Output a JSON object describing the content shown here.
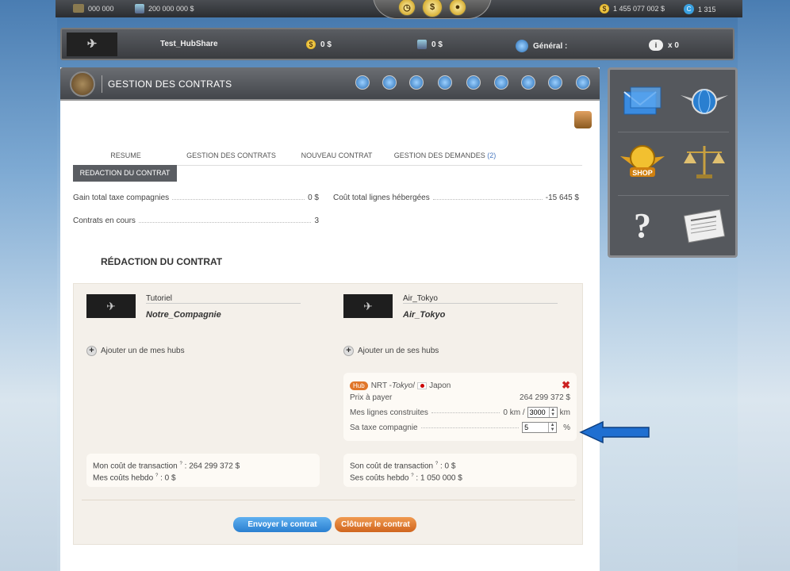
{
  "topbar": {
    "left_value": "000 000",
    "cash": "200 000 000 $",
    "right_cash": "1 455 077 002 $",
    "credits": "1 315"
  },
  "airline": {
    "name": "Test_HubShare",
    "money1": "0 $",
    "money2": "0 $",
    "general_label": "Général :",
    "messages": "x 0"
  },
  "header": {
    "title": "GESTION DES CONTRATS"
  },
  "tabs": [
    {
      "label": "RESUME"
    },
    {
      "label": "GESTION DES CONTRATS"
    },
    {
      "label": "NOUVEAU CONTRAT"
    },
    {
      "label": "GESTION DES DEMANDES",
      "count": "(2)"
    }
  ],
  "subtab": "REDACTION DU CONTRAT",
  "stats": {
    "gain_label": "Gain total taxe compagnies",
    "gain_value": "0 $",
    "cost_label": "Coût total lignes hébergées",
    "cost_value": "-15 645 $",
    "contracts_label": "Contrats en cours",
    "contracts_value": "3"
  },
  "section_title": "RÉDACTION DU CONTRAT",
  "left_party": {
    "name": "Tutoriel",
    "company": "Notre_Compagnie",
    "add_hub": "Ajouter un de mes hubs"
  },
  "right_party": {
    "name": "Air_Tokyo",
    "company": "Air_Tokyo",
    "add_hub": "Ajouter un de ses hubs"
  },
  "hub": {
    "badge": "Hub",
    "code": "NRT - ",
    "city": "Tokyo",
    "sep": " / ",
    "country": "Japon",
    "price_label": "Prix à payer",
    "price_value": "264 299 372 $",
    "lines_label": "Mes lignes construites",
    "lines_prefix": "0 km /",
    "lines_value": "3000",
    "lines_unit": "km",
    "tax_label": "Sa taxe compagnie",
    "tax_value": "5",
    "tax_unit": "%"
  },
  "left_costs": {
    "line1_label": "Mon coût de transaction",
    "line1_value": ": 264 299 372 $",
    "line2_label": "Mes coûts hebdo",
    "line2_value": ": 0 $"
  },
  "right_costs": {
    "line1_label": "Son coût de transaction",
    "line1_value": ": 0 $",
    "line2_label": "Ses coûts hebdo",
    "line2_value": ": 1 050 000 $"
  },
  "buttons": {
    "send": "Envoyer le contrat",
    "close": "Clôturer le contrat"
  },
  "right_panel": {
    "shop_label": "SHOP"
  },
  "colors": {
    "send_button": "#3a8fd8",
    "close_button": "#e0762a",
    "arrow": "#1f6fd1"
  }
}
